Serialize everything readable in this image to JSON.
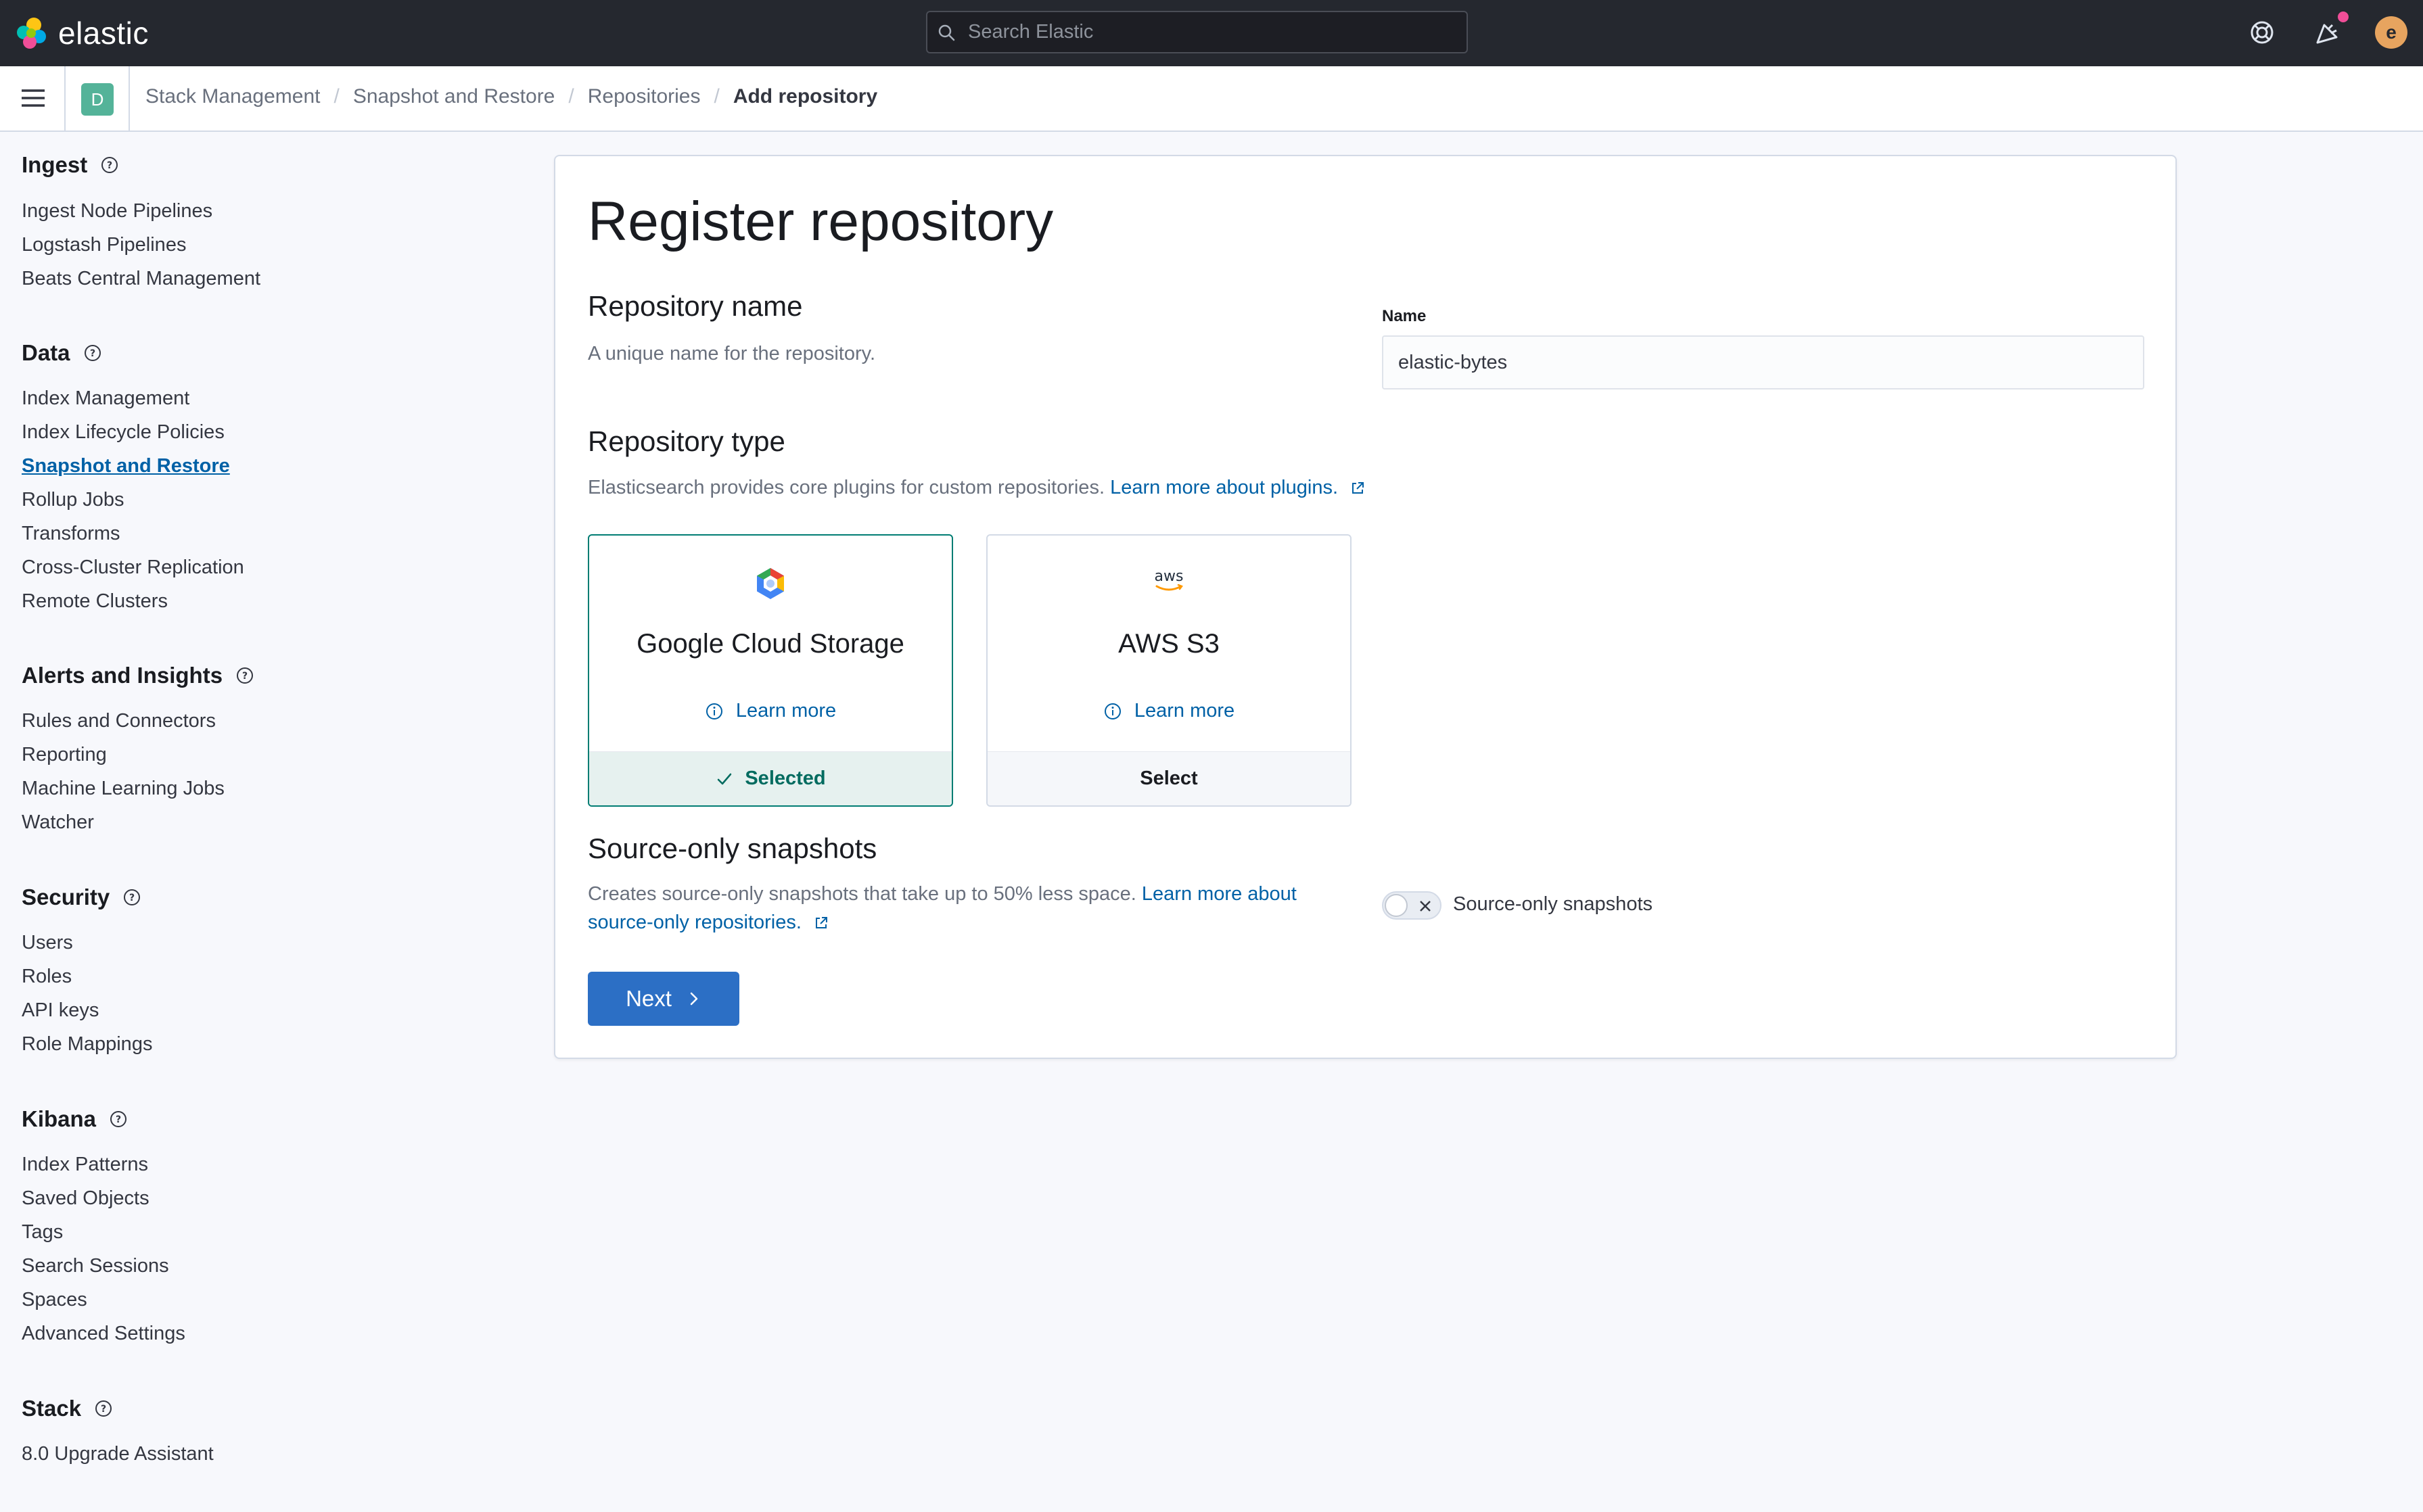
{
  "header": {
    "brand": "elastic",
    "search_placeholder": "Search Elastic",
    "avatar_initial": "e"
  },
  "breadcrumb": {
    "space_initial": "D",
    "items": [
      "Stack Management",
      "Snapshot and Restore",
      "Repositories"
    ],
    "current": "Add repository"
  },
  "sidebar": {
    "sections": [
      {
        "title": "Ingest",
        "items": [
          "Ingest Node Pipelines",
          "Logstash Pipelines",
          "Beats Central Management"
        ]
      },
      {
        "title": "Data",
        "items": [
          "Index Management",
          "Index Lifecycle Policies",
          "Snapshot and Restore",
          "Rollup Jobs",
          "Transforms",
          "Cross-Cluster Replication",
          "Remote Clusters"
        ]
      },
      {
        "title": "Alerts and Insights",
        "items": [
          "Rules and Connectors",
          "Reporting",
          "Machine Learning Jobs",
          "Watcher"
        ]
      },
      {
        "title": "Security",
        "items": [
          "Users",
          "Roles",
          "API keys",
          "Role Mappings"
        ]
      },
      {
        "title": "Kibana",
        "items": [
          "Index Patterns",
          "Saved Objects",
          "Tags",
          "Search Sessions",
          "Spaces",
          "Advanced Settings"
        ]
      },
      {
        "title": "Stack",
        "items": [
          "8.0 Upgrade Assistant"
        ]
      }
    ],
    "active_item": "Snapshot and Restore"
  },
  "main": {
    "title": "Register repository",
    "repo_name": {
      "heading": "Repository name",
      "description": "A unique name for the repository.",
      "field_label": "Name",
      "field_value": "elastic-bytes"
    },
    "repo_type": {
      "heading": "Repository type",
      "description": "Elasticsearch provides core plugins for custom repositories.",
      "link": "Learn more about plugins.",
      "cards": [
        {
          "title": "Google Cloud Storage",
          "learn_more": "Learn more",
          "footer": "Selected",
          "selected": true
        },
        {
          "title": "AWS S3",
          "learn_more": "Learn more",
          "footer": "Select",
          "selected": false
        }
      ]
    },
    "source_only": {
      "heading": "Source-only snapshots",
      "description": "Creates source-only snapshots that take up to 50% less space.",
      "link_line1": "Learn more about",
      "link_line2": "source-only repositories.",
      "toggle_label": "Source-only snapshots",
      "toggle_on": false
    },
    "next_button": "Next"
  },
  "colors": {
    "header_bg": "#25282f",
    "link": "#0061a6",
    "selected": "#017d73",
    "primary_button": "#2c6fc5"
  }
}
